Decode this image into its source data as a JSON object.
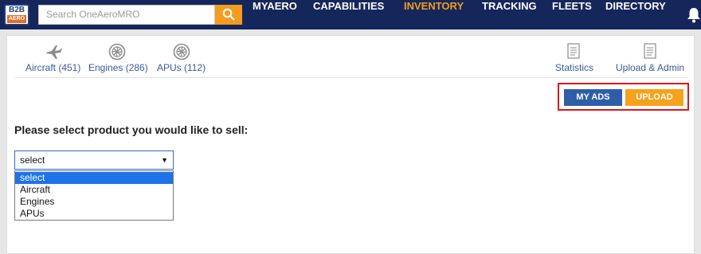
{
  "header": {
    "logo_top": "B2B",
    "logo_bottom": "AERO",
    "search_placeholder": "Search OneAeroMRO",
    "nav": [
      "MYAERO",
      "CAPABILITIES",
      "INVENTORY",
      "TRACKING",
      "FLEETS",
      "DIRECTORY"
    ],
    "active_nav": "INVENTORY"
  },
  "categories": [
    {
      "label": "Aircraft (451)",
      "icon": "airplane-icon"
    },
    {
      "label": "Engines (286)",
      "icon": "engine-icon"
    },
    {
      "label": "APUs (112)",
      "icon": "apu-icon"
    }
  ],
  "tools": [
    {
      "label": "Statistics",
      "icon": "document-icon"
    },
    {
      "label": "Upload & Admin",
      "icon": "document-icon"
    }
  ],
  "actions": {
    "my_ads": "MY ADS",
    "upload": "UPLOAD"
  },
  "form": {
    "heading": "Please select product you would like to sell:",
    "selected": "select",
    "options": [
      "select",
      "Aircraft",
      "Engines",
      "APUs"
    ]
  },
  "colors": {
    "header_bg": "#15275a",
    "accent_orange": "#f39c1f",
    "link_blue": "#3a5a9b",
    "button_blue": "#2e5ea8",
    "highlight_red": "#e0141c",
    "option_highlight": "#1e73e8"
  }
}
